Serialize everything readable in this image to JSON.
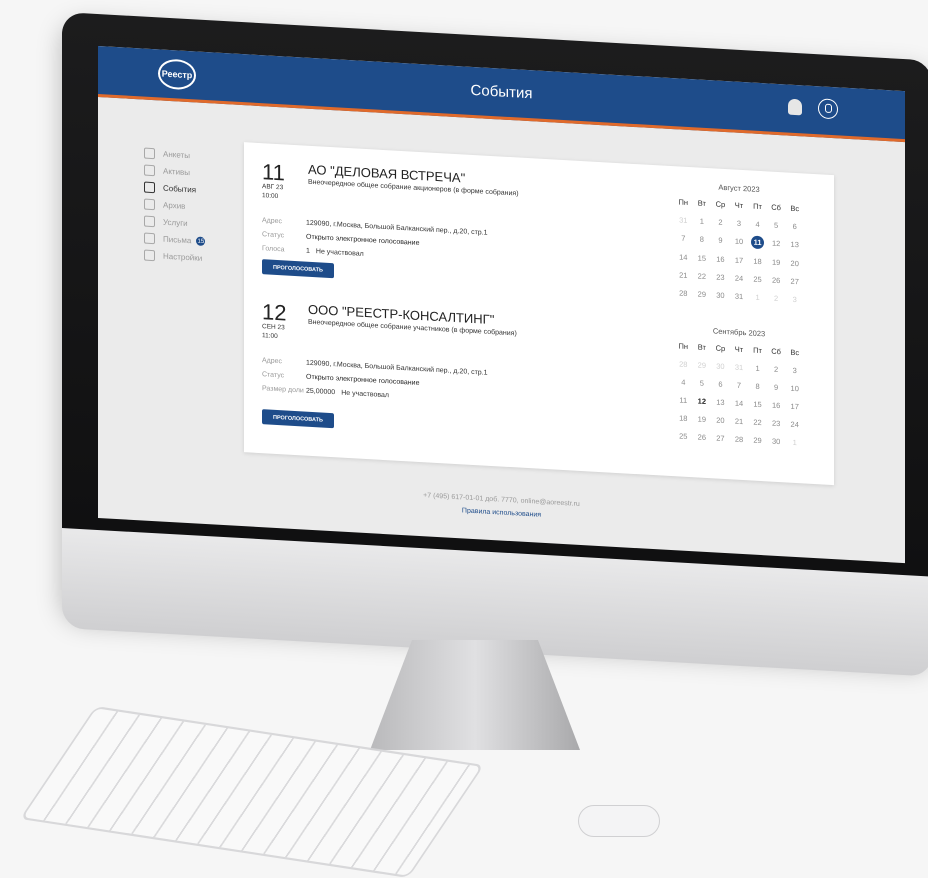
{
  "header": {
    "logo_text": "Реестр",
    "title": "События",
    "accent_color": "#1e4c8a",
    "stripe_color": "#e06a2b"
  },
  "sidebar": {
    "items": [
      {
        "label": "Анкеты",
        "icon": "form-icon"
      },
      {
        "label": "Активы",
        "icon": "coins-icon"
      },
      {
        "label": "События",
        "icon": "calendar-icon"
      },
      {
        "label": "Архив",
        "icon": "archive-icon"
      },
      {
        "label": "Услуги",
        "icon": "services-icon"
      },
      {
        "label": "Письма",
        "icon": "mail-icon",
        "badge": "15"
      },
      {
        "label": "Настройки",
        "icon": "gear-icon"
      }
    ]
  },
  "events": [
    {
      "day": "11",
      "month": "АВГ 23",
      "time": "10:00",
      "title": "АО \"ДЕЛОВАЯ ВСТРЕЧА\"",
      "subtitle": "Внеочередное общее собрание акционеров (в форме собрания)",
      "address_label": "Адрес",
      "address": "129090, г.Москва, Большой Балканский пер., д.20, стр.1",
      "status_label": "Статус",
      "status": "Открыто электронное голосование",
      "third_label": "Голоса",
      "third_value": "1",
      "third_note": "Не участвовал",
      "button": "ПРОГОЛОСОВАТЬ"
    },
    {
      "day": "12",
      "month": "СЕН 23",
      "time": "11:00",
      "title": "ООО \"РЕЕСТР-КОНСАЛТИНГ\"",
      "subtitle": "Внеочередное общее собрание участников (в форме собрания)",
      "address_label": "Адрес",
      "address": "129090, г.Москва, Большой Балканский пер., д.20, стр.1",
      "status_label": "Статус",
      "status": "Открыто электронное голосование",
      "third_label": "Размер доли",
      "third_value": "25,00000",
      "third_note": "Не участвовал",
      "button": "ПРОГОЛОСОВАТЬ"
    }
  ],
  "calendars": [
    {
      "title": "Август 2023",
      "weekdays": [
        "Пн",
        "Вт",
        "Ср",
        "Чт",
        "Пт",
        "Сб",
        "Вс"
      ],
      "days": [
        {
          "d": "31",
          "dim": true
        },
        {
          "d": "1"
        },
        {
          "d": "2"
        },
        {
          "d": "3"
        },
        {
          "d": "4"
        },
        {
          "d": "5"
        },
        {
          "d": "6"
        },
        {
          "d": "7"
        },
        {
          "d": "8"
        },
        {
          "d": "9"
        },
        {
          "d": "10"
        },
        {
          "d": "11",
          "selected": true
        },
        {
          "d": "12"
        },
        {
          "d": "13"
        },
        {
          "d": "14"
        },
        {
          "d": "15"
        },
        {
          "d": "16"
        },
        {
          "d": "17"
        },
        {
          "d": "18"
        },
        {
          "d": "19"
        },
        {
          "d": "20"
        },
        {
          "d": "21"
        },
        {
          "d": "22"
        },
        {
          "d": "23"
        },
        {
          "d": "24"
        },
        {
          "d": "25"
        },
        {
          "d": "26"
        },
        {
          "d": "27"
        },
        {
          "d": "28"
        },
        {
          "d": "29"
        },
        {
          "d": "30"
        },
        {
          "d": "31"
        },
        {
          "d": "1",
          "dim": true
        },
        {
          "d": "2",
          "dim": true
        },
        {
          "d": "3",
          "dim": true
        }
      ]
    },
    {
      "title": "Сентябрь 2023",
      "weekdays": [
        "Пн",
        "Вт",
        "Ср",
        "Чт",
        "Пт",
        "Сб",
        "Вс"
      ],
      "days": [
        {
          "d": "28",
          "dim": true
        },
        {
          "d": "29",
          "dim": true
        },
        {
          "d": "30",
          "dim": true
        },
        {
          "d": "31",
          "dim": true
        },
        {
          "d": "1"
        },
        {
          "d": "2"
        },
        {
          "d": "3"
        },
        {
          "d": "4"
        },
        {
          "d": "5"
        },
        {
          "d": "6"
        },
        {
          "d": "7"
        },
        {
          "d": "8"
        },
        {
          "d": "9"
        },
        {
          "d": "10"
        },
        {
          "d": "11"
        },
        {
          "d": "12",
          "bold": true
        },
        {
          "d": "13"
        },
        {
          "d": "14"
        },
        {
          "d": "15"
        },
        {
          "d": "16"
        },
        {
          "d": "17"
        },
        {
          "d": "18"
        },
        {
          "d": "19"
        },
        {
          "d": "20"
        },
        {
          "d": "21"
        },
        {
          "d": "22"
        },
        {
          "d": "23"
        },
        {
          "d": "24"
        },
        {
          "d": "25"
        },
        {
          "d": "26"
        },
        {
          "d": "27"
        },
        {
          "d": "28"
        },
        {
          "d": "29"
        },
        {
          "d": "30"
        },
        {
          "d": "1",
          "dim": true
        }
      ]
    }
  ],
  "footer": {
    "contact": "+7 (495) 617-01-01 доб. 7770, online@aoreestr.ru",
    "rules": "Правила использования"
  }
}
